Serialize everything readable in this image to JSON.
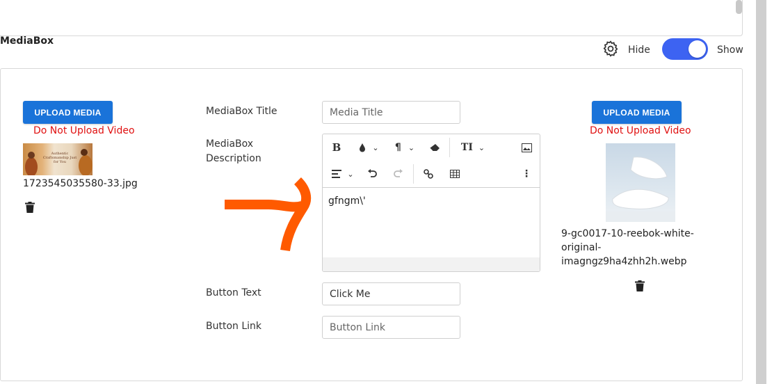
{
  "section": {
    "title": "MediaBox"
  },
  "visibility": {
    "hide_label": "Hide",
    "show_label": "Show",
    "value": "Show"
  },
  "left_media": {
    "upload_label": "UPLOAD MEDIA",
    "warning": "Do Not Upload Video",
    "thumbnail_caption": "Authentic Craftsmanship Just for You",
    "filename": "1723545035580-33.jpg"
  },
  "right_media": {
    "upload_label": "UPLOAD MEDIA",
    "warning": "Do Not Upload Video",
    "filename_lines": [
      "9-gc0017-10-reebok-white-",
      "original-",
      "imagngz9ha4zhh2h.webp"
    ]
  },
  "form": {
    "title_label": "MediaBox Title",
    "title_placeholder": "Media Title",
    "description_label_line1": "MediaBox",
    "description_label_line2": "Description",
    "description_value": "gfngm\\'",
    "button_text_label": "Button Text",
    "button_text_value": "Click Me",
    "button_link_label": "Button Link",
    "button_link_placeholder": "Button Link"
  },
  "toolbar": {
    "bold": "B",
    "paragraph": "¶",
    "text_size": "TI",
    "dropdown_caret": "⌄",
    "more": "⋮"
  },
  "colors": {
    "accent": "#3d63f2",
    "upload_button": "#1a73d9",
    "warning": "#e01010",
    "arrow": "#ff5a00"
  }
}
